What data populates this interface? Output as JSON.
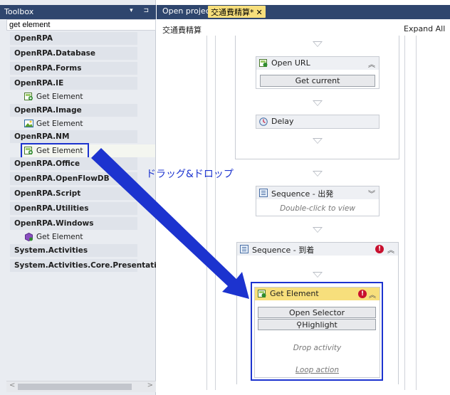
{
  "toolbox": {
    "title": "Toolbox",
    "title_buttons": "▾ ⊐",
    "search_value": "get element",
    "categories": [
      {
        "label": "OpenRPA"
      },
      {
        "label": "OpenRPA.Database"
      },
      {
        "label": "OpenRPA.Forms"
      },
      {
        "label": "OpenRPA.IE",
        "item": "Get Element"
      },
      {
        "label": "OpenRPA.Image",
        "item": "Get Element"
      },
      {
        "label": "OpenRPA.NM",
        "item": "Get Element"
      },
      {
        "label": "OpenRPA.Office"
      },
      {
        "label": "OpenRPA.OpenFlowDB"
      },
      {
        "label": "OpenRPA.Script"
      },
      {
        "label": "OpenRPA.Utilities"
      },
      {
        "label": "OpenRPA.Windows",
        "item": "Get Element"
      },
      {
        "label": "System.Activities"
      },
      {
        "label": "System.Activities.Core.Presentation"
      }
    ],
    "scroll_left": "<",
    "scroll_right": ">"
  },
  "tabs": {
    "open_project": "Open project",
    "active_tab": "交通費精算*",
    "close_glyph": "✕"
  },
  "designer": {
    "breadcrumb": "交通費精算",
    "expand_all": "Expand All",
    "open_url": {
      "title": "Open URL",
      "button": "Get current"
    },
    "delay": {
      "title": "Delay"
    },
    "seq_depart": {
      "title": "Sequence - 出発",
      "hint": "Double-click to view"
    },
    "seq_arrive": {
      "title": "Sequence - 到着"
    },
    "get_element": {
      "title": "Get Element",
      "open_selector": "Open Selector",
      "highlight": "Highlight",
      "drop_activity": "Drop activity",
      "loop_action": "Loop action"
    }
  },
  "annotation": {
    "drag_drop": "ドラッグ&ドロップ",
    "color": "#1c33cf"
  },
  "colors": {
    "titlebar": "#2f466e",
    "active_tab": "#f7df7c",
    "error": "#c8102e"
  }
}
